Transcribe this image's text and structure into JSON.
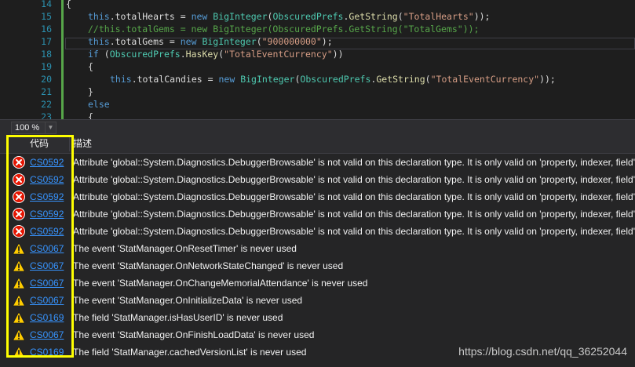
{
  "editor": {
    "zoom": "100 %",
    "lines": [
      {
        "num": "14",
        "parts": [
          {
            "t": "{",
            "c": ""
          }
        ]
      },
      {
        "num": "15",
        "parts": [
          {
            "t": "this",
            "c": "kw"
          },
          {
            "t": ".totalHearts = ",
            "c": ""
          },
          {
            "t": "new",
            "c": "kw"
          },
          {
            "t": " ",
            "c": ""
          },
          {
            "t": "BigInteger",
            "c": "ty"
          },
          {
            "t": "(",
            "c": ""
          },
          {
            "t": "ObscuredPrefs",
            "c": "ty"
          },
          {
            "t": ".",
            "c": ""
          },
          {
            "t": "GetString",
            "c": "fn"
          },
          {
            "t": "(",
            "c": ""
          },
          {
            "t": "\"TotalHearts\"",
            "c": "st"
          },
          {
            "t": "));",
            "c": ""
          }
        ]
      },
      {
        "num": "16",
        "parts": [
          {
            "t": "//this.totalGems = new BigInteger(ObscuredPrefs.GetString(\"TotalGems\"));",
            "c": "cm"
          }
        ]
      },
      {
        "num": "17",
        "parts": [
          {
            "t": "this",
            "c": "kw"
          },
          {
            "t": ".totalGems = ",
            "c": ""
          },
          {
            "t": "new",
            "c": "kw"
          },
          {
            "t": " ",
            "c": ""
          },
          {
            "t": "BigInteger",
            "c": "ty"
          },
          {
            "t": "(",
            "c": ""
          },
          {
            "t": "\"900000000\"",
            "c": "st"
          },
          {
            "t": ");",
            "c": ""
          }
        ]
      },
      {
        "num": "18",
        "parts": [
          {
            "t": "if",
            "c": "kw"
          },
          {
            "t": " (",
            "c": ""
          },
          {
            "t": "ObscuredPrefs",
            "c": "ty"
          },
          {
            "t": ".",
            "c": ""
          },
          {
            "t": "HasKey",
            "c": "fn"
          },
          {
            "t": "(",
            "c": ""
          },
          {
            "t": "\"TotalEventCurrency\"",
            "c": "st"
          },
          {
            "t": "))",
            "c": ""
          }
        ]
      },
      {
        "num": "19",
        "parts": [
          {
            "t": "{",
            "c": ""
          }
        ]
      },
      {
        "num": "20",
        "parts": [
          {
            "t": "this",
            "c": "kw"
          },
          {
            "t": ".totalCandies = ",
            "c": ""
          },
          {
            "t": "new",
            "c": "kw"
          },
          {
            "t": " ",
            "c": ""
          },
          {
            "t": "BigInteger",
            "c": "ty"
          },
          {
            "t": "(",
            "c": ""
          },
          {
            "t": "ObscuredPrefs",
            "c": "ty"
          },
          {
            "t": ".",
            "c": ""
          },
          {
            "t": "GetString",
            "c": "fn"
          },
          {
            "t": "(",
            "c": ""
          },
          {
            "t": "\"TotalEventCurrency\"",
            "c": "st"
          },
          {
            "t": "));",
            "c": ""
          }
        ]
      },
      {
        "num": "21",
        "parts": [
          {
            "t": "}",
            "c": ""
          }
        ]
      },
      {
        "num": "22",
        "parts": [
          {
            "t": "else",
            "c": "kw"
          }
        ]
      },
      {
        "num": "23",
        "parts": [
          {
            "t": "{",
            "c": ""
          }
        ]
      }
    ]
  },
  "error_list": {
    "header_code": "代码",
    "header_desc": "描述",
    "rows": [
      {
        "severity": "error",
        "icon": "error-icon",
        "code": "CS0592",
        "desc": "Attribute 'global::System.Diagnostics.DebuggerBrowsable' is not valid on this declaration type. It is only valid on 'property, indexer, field' declarations."
      },
      {
        "severity": "error",
        "icon": "error-icon",
        "code": "CS0592",
        "desc": "Attribute 'global::System.Diagnostics.DebuggerBrowsable' is not valid on this declaration type. It is only valid on 'property, indexer, field' declarations."
      },
      {
        "severity": "error",
        "icon": "error-icon",
        "code": "CS0592",
        "desc": "Attribute 'global::System.Diagnostics.DebuggerBrowsable' is not valid on this declaration type. It is only valid on 'property, indexer, field' declarations."
      },
      {
        "severity": "error",
        "icon": "error-icon",
        "code": "CS0592",
        "desc": "Attribute 'global::System.Diagnostics.DebuggerBrowsable' is not valid on this declaration type. It is only valid on 'property, indexer, field' declarations."
      },
      {
        "severity": "error",
        "icon": "error-icon",
        "code": "CS0592",
        "desc": "Attribute 'global::System.Diagnostics.DebuggerBrowsable' is not valid on this declaration type. It is only valid on 'property, indexer, field' declarations."
      },
      {
        "severity": "warning",
        "icon": "warning-icon",
        "code": "CS0067",
        "desc": "The event 'StatManager.OnResetTimer' is never used"
      },
      {
        "severity": "warning",
        "icon": "warning-icon",
        "code": "CS0067",
        "desc": "The event 'StatManager.OnNetworkStateChanged' is never used"
      },
      {
        "severity": "warning",
        "icon": "warning-icon",
        "code": "CS0067",
        "desc": "The event 'StatManager.OnChangeMemorialAttendance' is never used"
      },
      {
        "severity": "warning",
        "icon": "warning-icon",
        "code": "CS0067",
        "desc": "The event 'StatManager.OnInitializeData' is never used"
      },
      {
        "severity": "warning",
        "icon": "warning-icon",
        "code": "CS0169",
        "desc": "The field 'StatManager.isHasUserID' is never used"
      },
      {
        "severity": "warning",
        "icon": "warning-icon",
        "code": "CS0067",
        "desc": "The event 'StatManager.OnFinishLoadData' is never used"
      },
      {
        "severity": "warning",
        "icon": "warning-icon",
        "code": "CS0169",
        "desc": "The field 'StatManager.cachedVersionList' is never used"
      }
    ]
  },
  "watermark": "https://blog.csdn.net/qq_36252044",
  "colors": {
    "error": "#e51400",
    "warning": "#ffcc00",
    "highlight_frame": "#ffff00",
    "link": "#3794ff"
  }
}
